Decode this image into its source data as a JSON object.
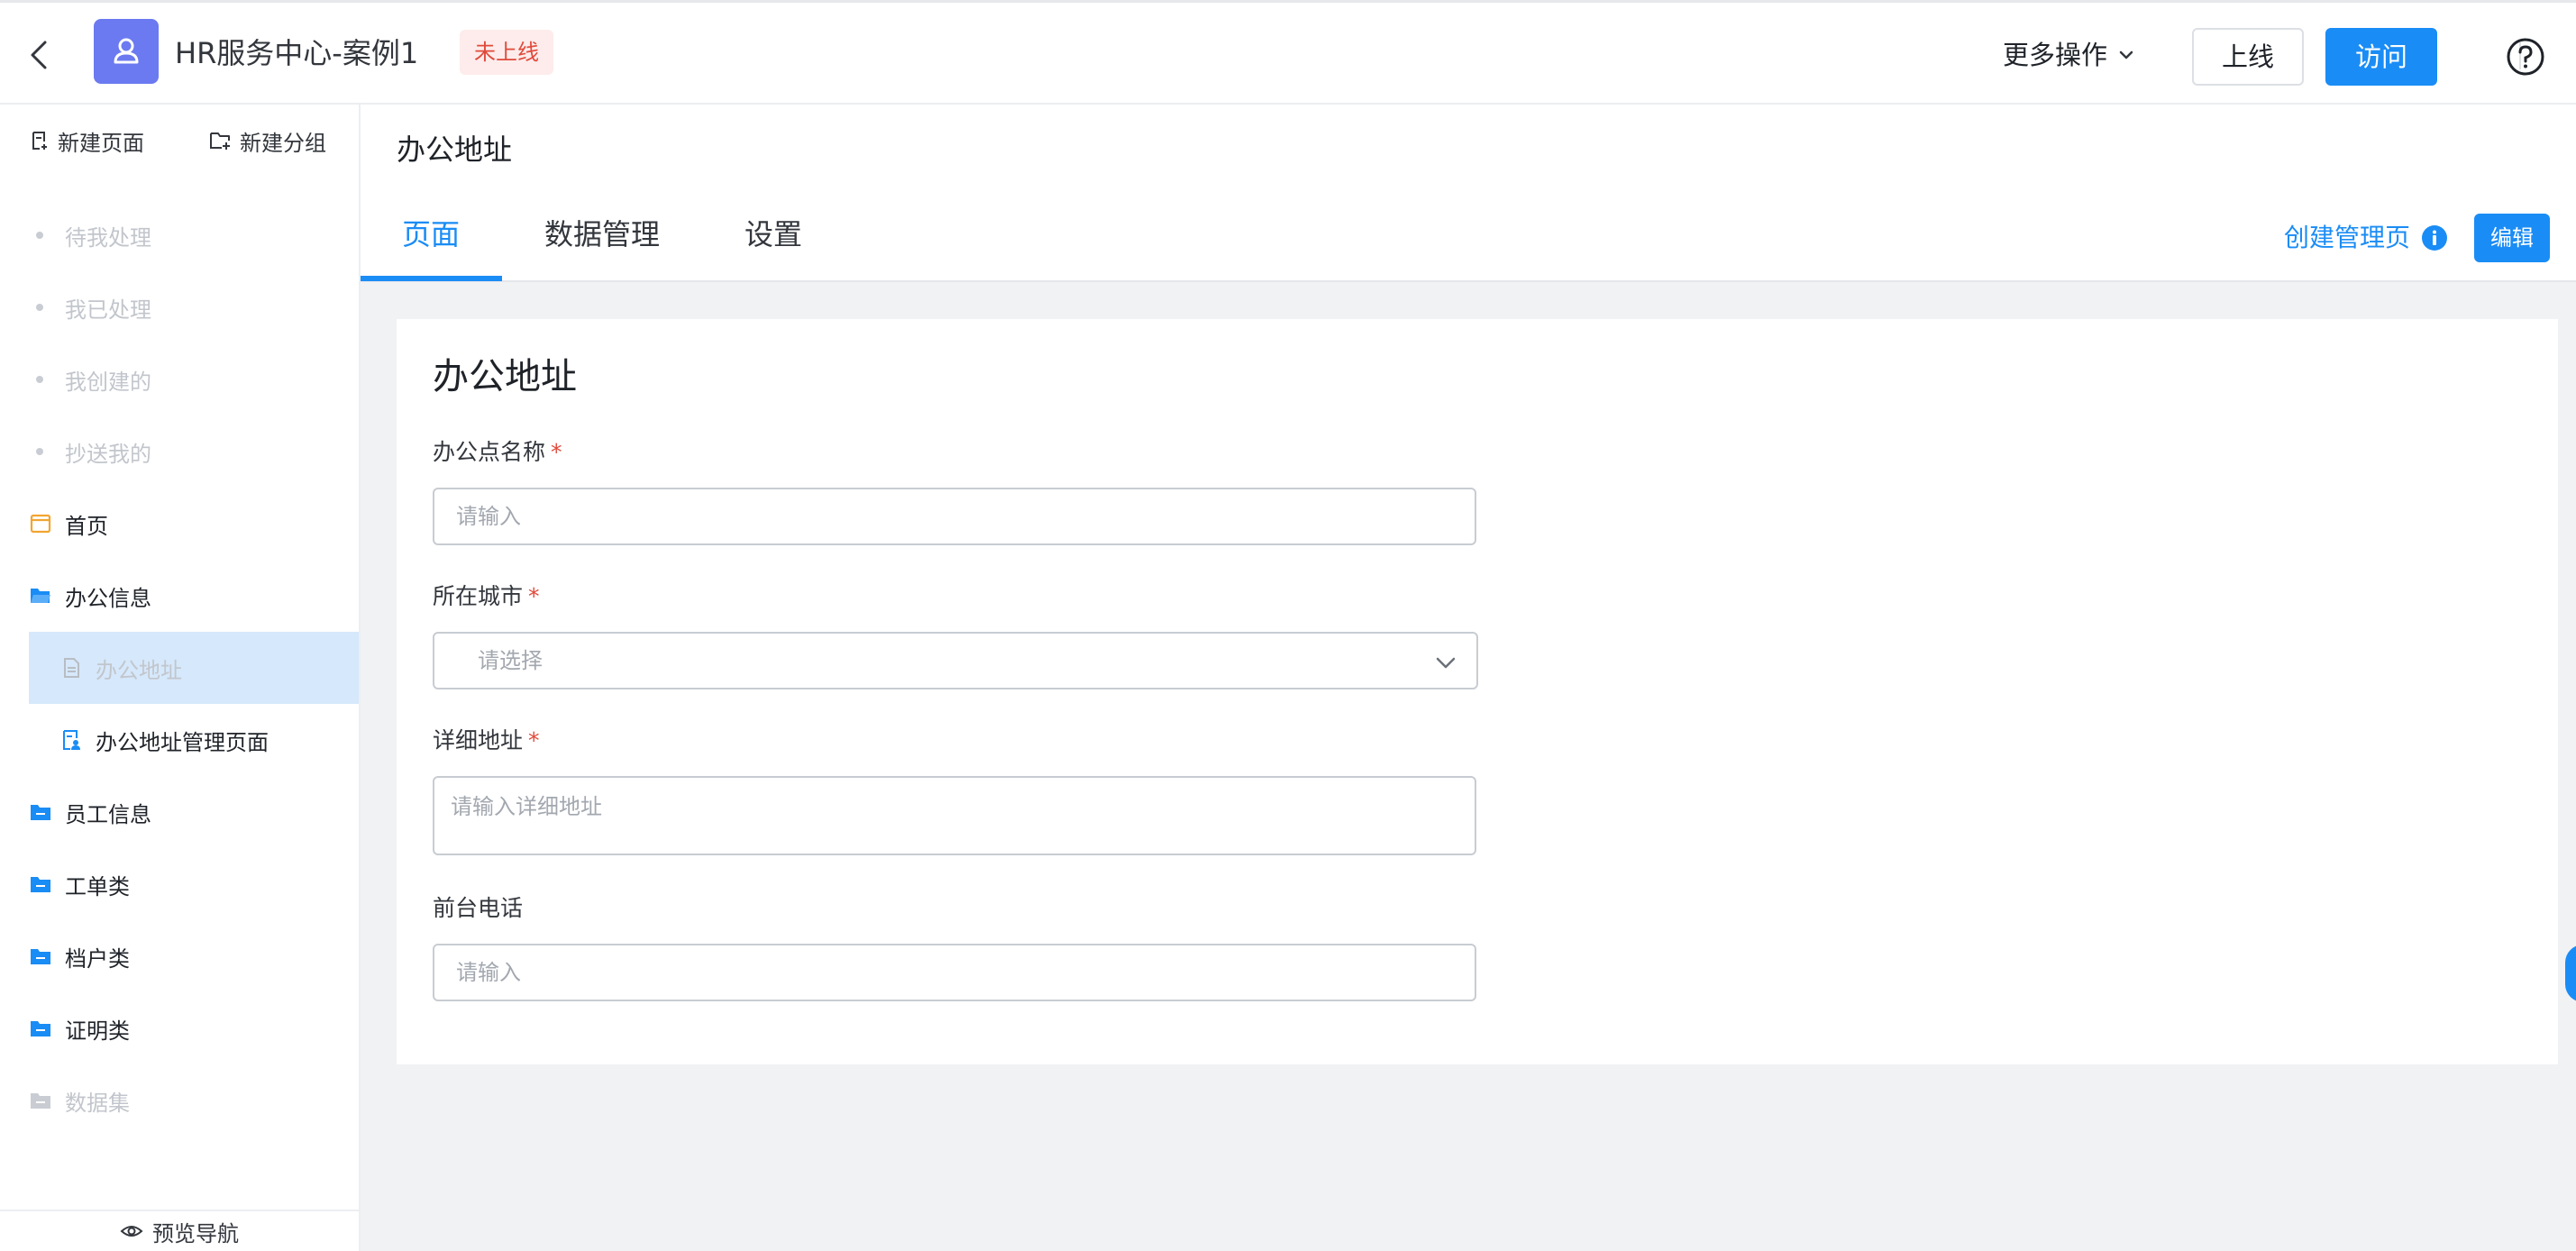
{
  "header": {
    "app_title": "HR服务中心-案例1",
    "status_badge": "未上线",
    "more_actions_label": "更多操作",
    "online_button": "上线",
    "visit_button": "访问",
    "app_icon_color": "#6b7af0",
    "accent_color": "#1a8cf5"
  },
  "sidebar": {
    "new_page_label": "新建页面",
    "new_group_label": "新建分组",
    "items": [
      {
        "label": "待我处理",
        "icon": "bullet-dot",
        "state": "disabled"
      },
      {
        "label": "我已处理",
        "icon": "bullet-dot",
        "state": "disabled"
      },
      {
        "label": "我创建的",
        "icon": "bullet-dot",
        "state": "disabled"
      },
      {
        "label": "抄送我的",
        "icon": "bullet-dot",
        "state": "disabled"
      },
      {
        "label": "首页",
        "icon": "page-icon",
        "state": "normal"
      },
      {
        "label": "办公信息",
        "icon": "folder-open-icon",
        "state": "normal"
      },
      {
        "label": "办公地址",
        "icon": "form-page-icon",
        "state": "selected"
      },
      {
        "label": "办公地址管理页面",
        "icon": "manage-page-icon",
        "state": "normal"
      },
      {
        "label": "员工信息",
        "icon": "folder-icon",
        "state": "normal"
      },
      {
        "label": "工单类",
        "icon": "folder-icon",
        "state": "normal"
      },
      {
        "label": "档户类",
        "icon": "folder-icon",
        "state": "normal"
      },
      {
        "label": "证明类",
        "icon": "folder-icon",
        "state": "normal"
      },
      {
        "label": "数据集",
        "icon": "folder-icon",
        "state": "disabled"
      }
    ],
    "preview_nav_label": "预览导航"
  },
  "main": {
    "page_name": "办公地址",
    "tabs": [
      {
        "label": "页面",
        "active": true
      },
      {
        "label": "数据管理",
        "active": false
      },
      {
        "label": "设置",
        "active": false
      }
    ],
    "create_manage_page_label": "创建管理页",
    "edit_button": "编辑"
  },
  "form": {
    "title": "办公地址",
    "fields": {
      "office_name": {
        "label": "办公点名称",
        "required": "*",
        "placeholder": "请输入",
        "value": ""
      },
      "city": {
        "label": "所在城市",
        "required": "*",
        "placeholder": "请选择",
        "value": ""
      },
      "address": {
        "label": "详细地址",
        "required": "*",
        "placeholder": "请输入详细地址",
        "value": ""
      },
      "phone": {
        "label": "前台电话",
        "placeholder": "请输入",
        "value": ""
      }
    }
  }
}
